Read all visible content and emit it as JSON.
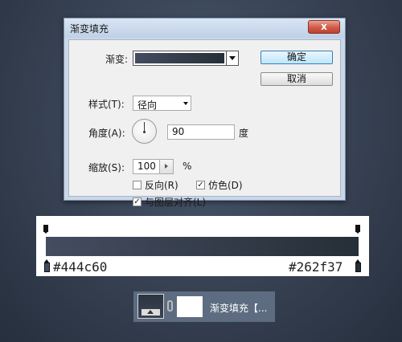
{
  "dialog": {
    "title": "渐变填充",
    "close_label": "x",
    "gradient_label": "渐变:",
    "style_label": "样式(T):",
    "style_value": "径向",
    "angle_label": "角度(A):",
    "angle_value": "90",
    "angle_unit": "度",
    "scale_label": "缩放(S):",
    "scale_value": "100",
    "scale_unit": "%",
    "reverse_label": "反向(R)",
    "reverse_checked": false,
    "dither_label": "仿色(D)",
    "dither_checked": true,
    "align_label": "与图层对齐(L)",
    "align_checked": true,
    "ok_label": "确定",
    "cancel_label": "取消"
  },
  "gradient_bar": {
    "left_color": "#444c60",
    "right_color": "#262f37"
  },
  "layer": {
    "name": "渐变填充【..."
  },
  "icons": {
    "close": "close-icon",
    "dropdown": "chevron-down-icon",
    "stepper": "chevron-right-icon",
    "link": "link-icon"
  }
}
